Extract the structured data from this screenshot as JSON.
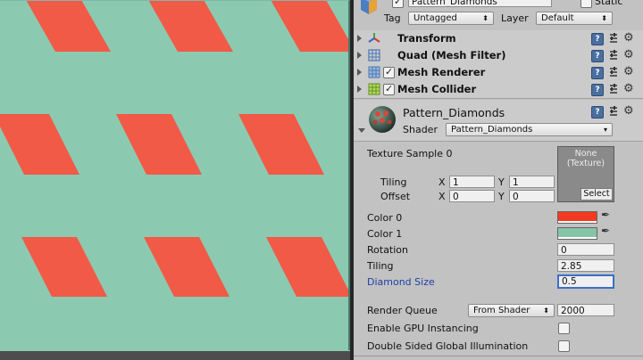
{
  "scene": {
    "bg_color": "#8cc9b1",
    "shape_color": "#f15a46"
  },
  "header": {
    "object_name": "Pattern_Diamonds",
    "static_label": "Static",
    "tag_label": "Tag",
    "tag_value": "Untagged",
    "layer_label": "Layer",
    "layer_value": "Default"
  },
  "components": [
    {
      "name": "Transform"
    },
    {
      "name": "Quad (Mesh Filter)"
    },
    {
      "name": "Mesh Renderer"
    },
    {
      "name": "Mesh Collider"
    }
  ],
  "material": {
    "name": "Pattern_Diamonds",
    "shader_label": "Shader",
    "shader_value": "Pattern_Diamonds"
  },
  "texture": {
    "label": "Texture Sample 0",
    "preview_text": "None\n(Texture)",
    "select_label": "Select",
    "tiling_label": "Tiling",
    "offset_label": "Offset",
    "x_label": "X",
    "y_label": "Y",
    "tiling_x": "1",
    "tiling_y": "1",
    "offset_x": "0",
    "offset_y": "0"
  },
  "properties": {
    "color0_label": "Color 0",
    "color0": "#f23a20",
    "color1_label": "Color 1",
    "color1": "#86c4a8",
    "rotation_label": "Rotation",
    "rotation_value": "0",
    "tiling_label": "Tiling",
    "tiling_value": "2.85",
    "diamond_label": "Diamond Size",
    "diamond_value": "0.5"
  },
  "render": {
    "queue_label": "Render Queue",
    "queue_mode": "From Shader",
    "queue_value": "2000",
    "gpu_label": "Enable GPU Instancing",
    "dsgi_label": "Double Sided Global Illumination"
  }
}
